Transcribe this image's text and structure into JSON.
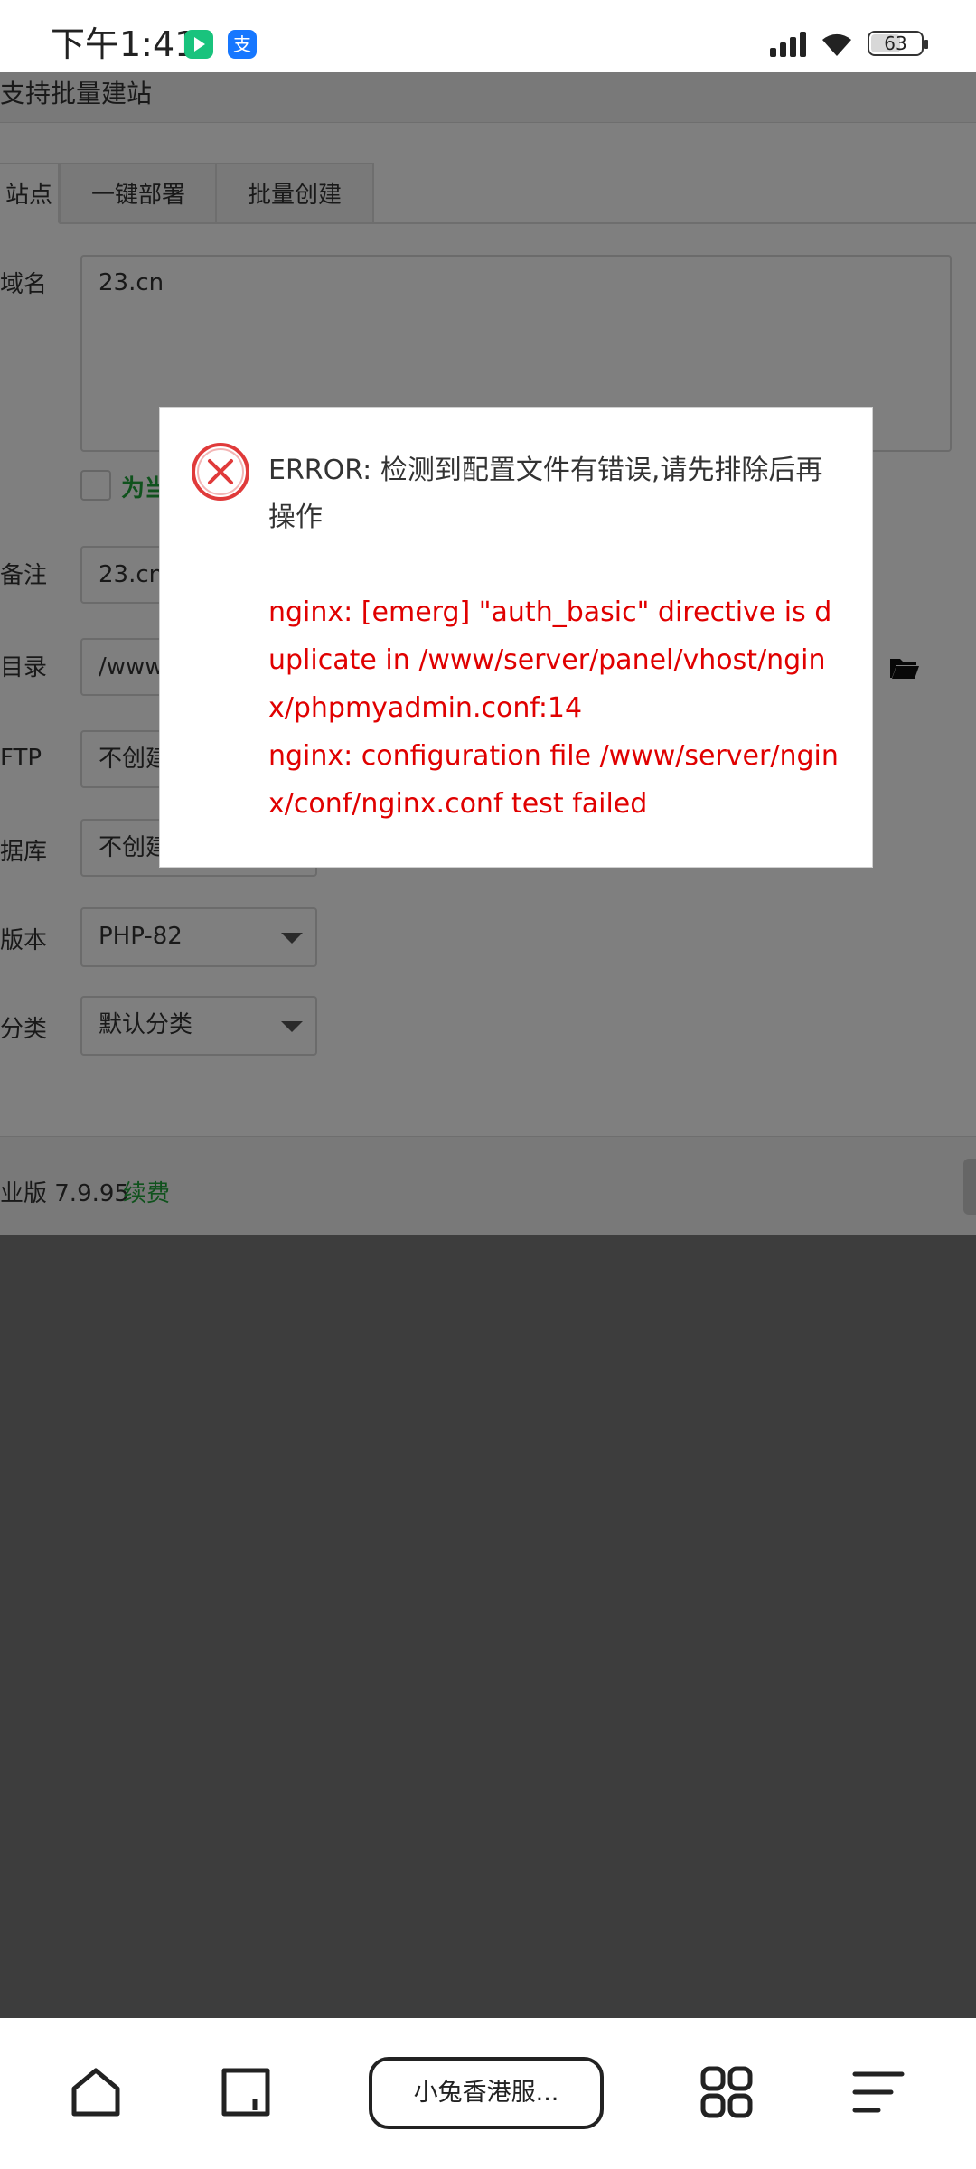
{
  "status_bar": {
    "time": "下午1:41",
    "battery": "63"
  },
  "page": {
    "header_text": "支持批量建站",
    "tabs": [
      "站点",
      "一键部署",
      "批量创建"
    ],
    "form": {
      "domain_label": "域名",
      "domain_value": "23.cn",
      "checkbox_label": "为当",
      "remark_label": "备注",
      "remark_value": "23.cn",
      "dir_label": "目录",
      "dir_value": "/www",
      "ftp_label": "FTP",
      "ftp_value": "不创建",
      "db_label": "据库",
      "db_value": "不创建",
      "php_label": "版本",
      "php_value": "PHP-82",
      "category_label": "分类",
      "category_value": "默认分类"
    },
    "footer": {
      "version": "业版 7.9.95",
      "renew": "续费"
    }
  },
  "dialog": {
    "icon": "error-circle-x-icon",
    "title": "ERROR: 检测到配置文件有错误,请先排除后再操作",
    "detail_line1": "nginx: [emerg] \"auth_basic\" directive is duplicate in /www/server/panel/vhost/nginx/phpmyadmin.conf:14",
    "detail_line2": "nginx: configuration file /www/server/nginx/conf/nginx.conf test failed"
  },
  "browser_nav": {
    "url_label": "小兔香港服...",
    "icons": [
      "home-icon",
      "tabs-icon",
      "apps-grid-icon",
      "menu-icon"
    ]
  },
  "colors": {
    "error_red": "#e00000",
    "accent_green": "#20a53a"
  }
}
